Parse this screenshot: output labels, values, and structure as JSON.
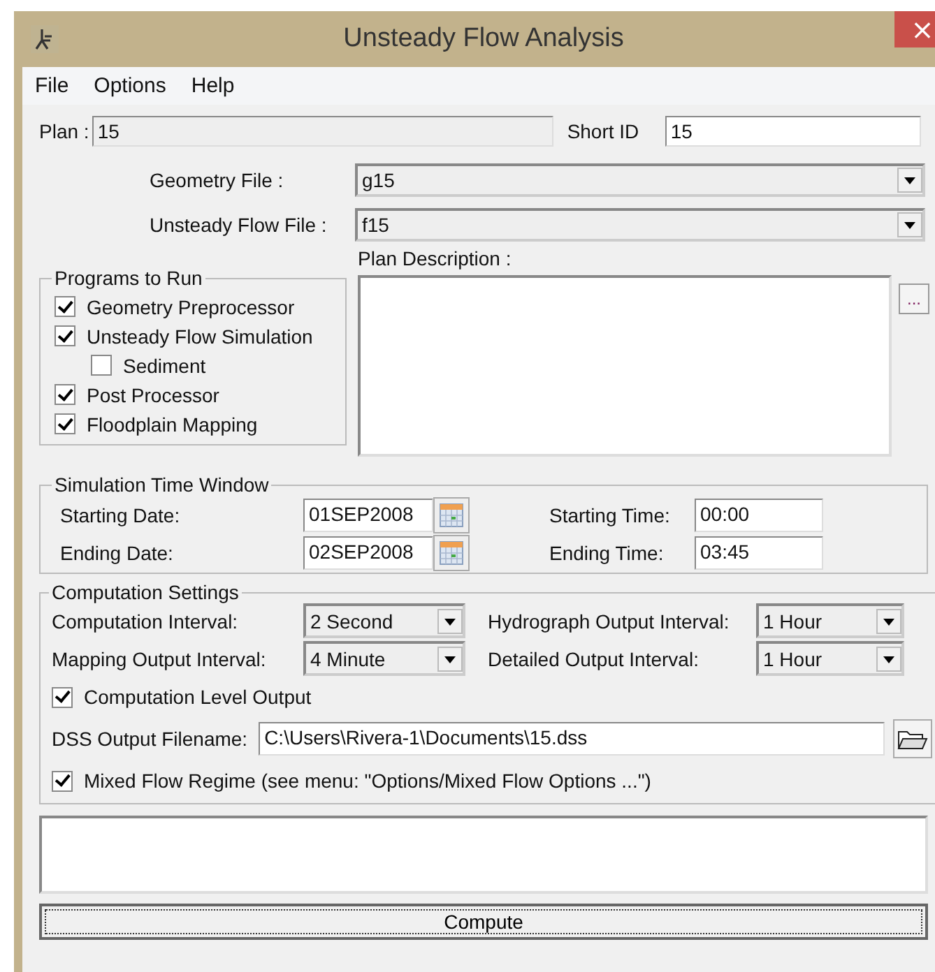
{
  "window": {
    "title": "Unsteady Flow Analysis",
    "close": "×"
  },
  "menu": [
    {
      "label": "File"
    },
    {
      "label": "Options"
    },
    {
      "label": "Help"
    }
  ],
  "plan": {
    "label": "Plan :",
    "value": "15"
  },
  "short_id": {
    "label": "Short ID",
    "value": "15"
  },
  "geometry_file": {
    "label": "Geometry File :",
    "value": "g15"
  },
  "unsteady_flow_file": {
    "label": "Unsteady Flow File :",
    "value": "f15"
  },
  "plan_description": {
    "label": "Plan Description :",
    "button": "..."
  },
  "programs": {
    "title": "Programs to Run",
    "items": [
      {
        "label": "Geometry Preprocessor",
        "checked": true
      },
      {
        "label": "Unsteady Flow Simulation",
        "checked": true,
        "children": [
          {
            "label": "Sediment",
            "checked": false
          }
        ]
      },
      {
        "label": "Post Processor",
        "checked": true
      },
      {
        "label": "Floodplain Mapping",
        "checked": true
      }
    ]
  },
  "simulation_time_window": {
    "title": "Simulation Time Window",
    "starting_date": {
      "label": "Starting Date:",
      "value": "01SEP2008"
    },
    "ending_date": {
      "label": "Ending Date:",
      "value": "02SEP2008"
    },
    "starting_time": {
      "label": "Starting Time:",
      "value": "00:00"
    },
    "ending_time": {
      "label": "Ending Time:",
      "value": "03:45"
    }
  },
  "computation_settings": {
    "title": "Computation Settings",
    "intervals": [
      {
        "label": "Computation Interval:",
        "value": "2 Second"
      },
      {
        "label": "Hydrograph Output Interval:",
        "value": "1 Hour"
      },
      {
        "label": "Mapping Output Interval:",
        "value": "4 Minute"
      },
      {
        "label": "Detailed Output Interval:",
        "value": "1 Hour"
      }
    ],
    "computation_level_output": {
      "label": "Computation Level Output",
      "checked": true
    },
    "dss_output": {
      "label": "DSS Output Filename:",
      "value": "C:\\Users\\Rivera-1\\Documents\\15.dss"
    },
    "mixed_flow": {
      "label": "Mixed Flow Regime (see menu: \"Options/Mixed Flow Options ...\")",
      "checked": true
    }
  },
  "compute_button": "Compute"
}
